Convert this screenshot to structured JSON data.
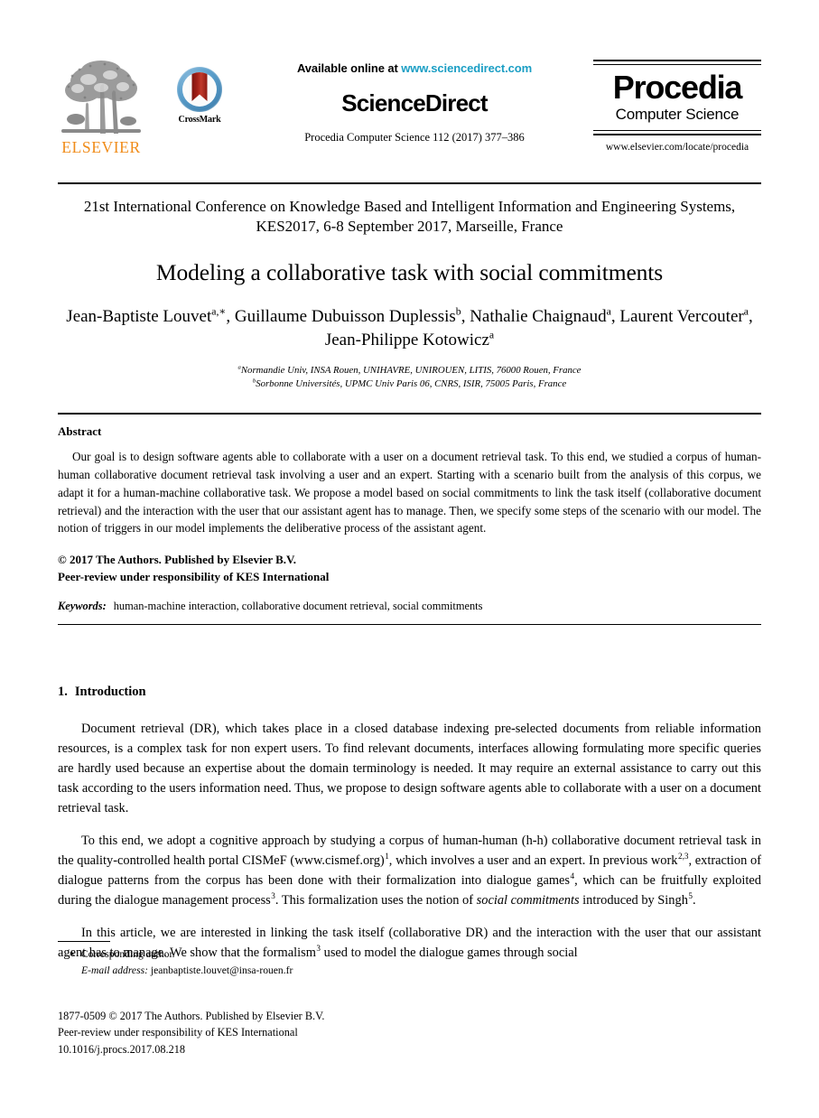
{
  "masthead": {
    "elsevier_logo_word": "ELSEVIER",
    "crossmark_label": "CrossMark",
    "available_prefix": "Available online at ",
    "available_url": "www.sciencedirect.com",
    "sciencedirect_title": "ScienceDirect",
    "journal_citation": "Procedia Computer Science 112 (2017) 377–386",
    "procedia_name": "Procedia",
    "procedia_subtitle": "Computer Science",
    "procedia_url": "www.elsevier.com/locate/procedia",
    "link_color": "#1a9ec4",
    "elsevier_orange": "#f08c1a"
  },
  "conference": "21st International Conference on Knowledge Based and Intelligent Information and Engineering Systems, KES2017, 6-8 September 2017, Marseille, France",
  "title": "Modeling a collaborative task with social commitments",
  "authors": {
    "line1_a": "Jean-Baptiste Louvet",
    "line1_a_sup": "a,∗",
    "line1_b": ", Guillaume Dubuisson Duplessis",
    "line1_b_sup": "b",
    "line1_c": ", Nathalie Chaignaud",
    "line1_c_sup": "a",
    "line1_d": ", Laurent",
    "line2_a": "Vercouter",
    "line2_a_sup": "a",
    "line2_b": ", Jean-Philippe Kotowicz",
    "line2_b_sup": "a"
  },
  "affiliations": [
    {
      "sup": "a",
      "text": "Normandie Univ, INSA Rouen, UNIHAVRE, UNIROUEN, LITIS, 76000 Rouen, France"
    },
    {
      "sup": "b",
      "text": "Sorbonne Universités, UPMC Univ Paris 06, CNRS, ISIR, 75005 Paris, France"
    }
  ],
  "abstract": {
    "heading": "Abstract",
    "body": "Our goal is to design software agents able to collaborate with a user on a document retrieval task. To this end, we studied a corpus of human-human collaborative document retrieval task involving a user and an expert. Starting with a scenario built from the analysis of this corpus, we adapt it for a human-machine collaborative task. We propose a model based on social commitments to link the task itself (collaborative document retrieval) and the interaction with the user that our assistant agent has to manage. Then, we specify some steps of the scenario with our model. The notion of triggers in our model implements the deliberative process of the assistant agent.",
    "copyright_line1": "© 2017 The Authors. Published by Elsevier B.V.",
    "copyright_line2": "Peer-review under responsibility of KES International",
    "keywords_label": "Keywords:",
    "keywords_list": "human-machine interaction, collaborative document retrieval, social commitments"
  },
  "introduction": {
    "number": "1.",
    "heading": "Introduction",
    "p1": "Document retrieval (DR), which takes place in a closed database indexing pre-selected documents from reliable information resources, is a complex task for non expert users. To find relevant documents, interfaces allowing formulating more specific queries are hardly used because an expertise about the domain terminology is needed. It may require an external assistance to carry out this task according to the users information need. Thus, we propose to design software agents able to collaborate with a user on a document retrieval task.",
    "p2_seg1": "To this end, we adopt a cognitive approach by studying a corpus of human-human (h-h) collaborative document retrieval task in the quality-controlled health portal CISMeF (www.cismef.org)",
    "p2_sup1": "1",
    "p2_seg2": ", which involves a user and an expert. In previous work",
    "p2_sup2": "2,3",
    "p2_seg3": ", extraction of dialogue patterns from the corpus has been done with their formalization into dialogue games",
    "p2_sup3": "4",
    "p2_seg4": ", which can be fruitfully exploited during the dialogue management process",
    "p2_sup4": "3",
    "p2_seg5": ". This formalization uses the notion of ",
    "p2_italic": "social commitments",
    "p2_seg6": " introduced by Singh",
    "p2_sup5": "5",
    "p2_seg7": ".",
    "p3_seg1": "In this article, we are interested in linking the task itself (collaborative DR) and the interaction with the user that our assistant agent has to manage. We show that the formalism",
    "p3_sup1": "3",
    "p3_seg2": " used to model the dialogue games through social"
  },
  "footnote": {
    "star": "∗",
    "corresponding": "Corresponding author.",
    "email_label": "E-mail address:",
    "email_value": "jeanbaptiste.louvet@insa-rouen.fr"
  },
  "footer": {
    "line1": "1877-0509 © 2017 The Authors. Published by Elsevier B.V.",
    "line2": "Peer-review under responsibility of KES International",
    "line3": "10.1016/j.procs.2017.08.218"
  }
}
